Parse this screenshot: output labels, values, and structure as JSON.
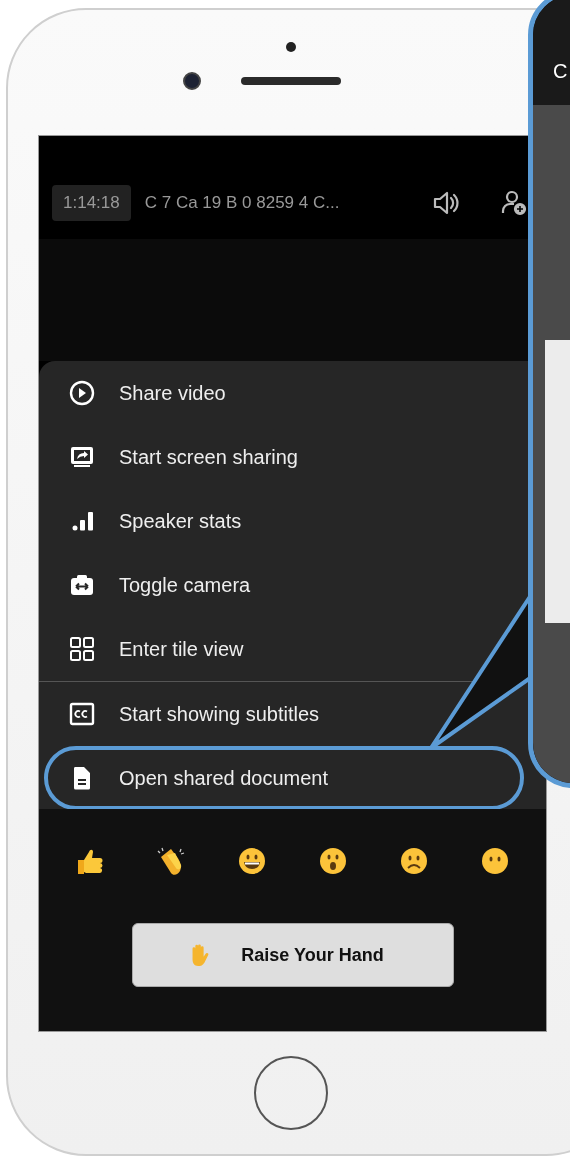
{
  "header": {
    "time": "1:14:18",
    "title": "C 7 Ca 19 B 0 8259 4 C..."
  },
  "menu": {
    "sections": [
      [
        {
          "kind": "play",
          "label": "Share video",
          "highlighted": false
        },
        {
          "kind": "screen",
          "label": "Start screen sharing",
          "highlighted": false
        },
        {
          "kind": "stats",
          "label": "Speaker stats",
          "highlighted": false
        },
        {
          "kind": "camera",
          "label": "Toggle camera",
          "highlighted": false
        },
        {
          "kind": "grid",
          "label": "Enter tile view",
          "highlighted": false
        }
      ],
      [
        {
          "kind": "cc",
          "label": "Start showing subtitles",
          "highlighted": false
        },
        {
          "kind": "document",
          "label": "Open shared document",
          "highlighted": true
        }
      ]
    ]
  },
  "reactions": [
    {
      "kind": "thumbs-up"
    },
    {
      "kind": "clap"
    },
    {
      "kind": "grin"
    },
    {
      "kind": "surprised"
    },
    {
      "kind": "frown"
    },
    {
      "kind": "neutral"
    }
  ],
  "raise_hand_button": {
    "label": "Raise Your Hand"
  },
  "callout": {
    "text": "C"
  }
}
